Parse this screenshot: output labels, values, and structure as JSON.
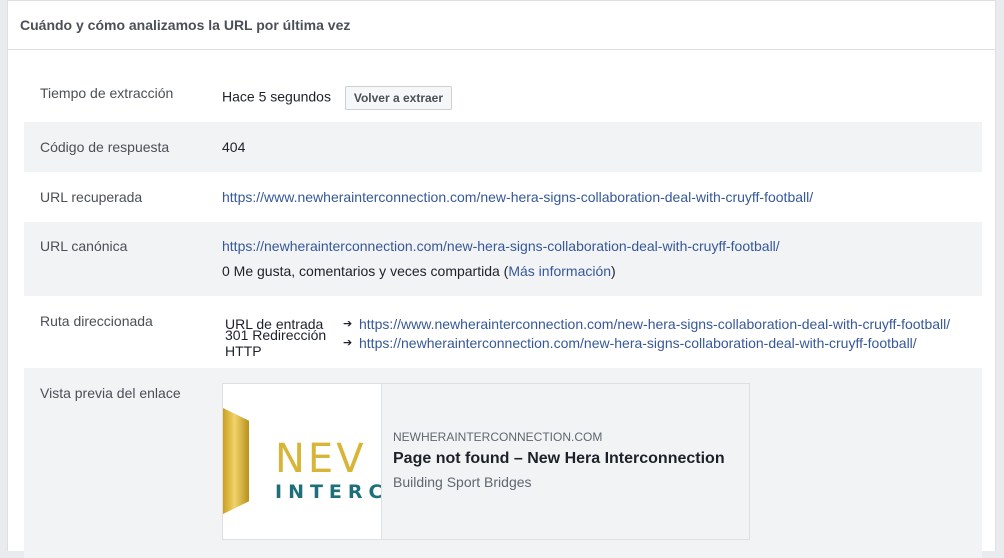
{
  "header": {
    "title": "Cuándo y cómo analizamos la URL por última vez"
  },
  "rows": {
    "scrape_time": {
      "label": "Tiempo de extracción",
      "value": "Hace 5 segundos",
      "button": "Volver a extraer"
    },
    "response_code": {
      "label": "Código de respuesta",
      "value": "404"
    },
    "fetched_url": {
      "label": "URL recuperada",
      "value": "https://www.newherainterconnection.com/new-hera-signs-collaboration-deal-with-cruyff-football/"
    },
    "canonical_url": {
      "label": "URL canónica",
      "value": "https://newherainterconnection.com/new-hera-signs-collaboration-deal-with-cruyff-football/",
      "engagement_text": "0 Me gusta, comentarios y veces compartida (",
      "more_info": "Más información",
      "engagement_close": ")"
    },
    "redirect_path": {
      "label": "Ruta direccionada",
      "entries": [
        {
          "type": "URL de entrada",
          "arrow": "➔",
          "url": "https://www.newherainterconnection.com/new-hera-signs-collaboration-deal-with-cruyff-football/"
        },
        {
          "type": "301 Redirección HTTP",
          "arrow": "➔",
          "url": "https://newherainterconnection.com/new-hera-signs-collaboration-deal-with-cruyff-football/"
        }
      ]
    },
    "link_preview": {
      "label": "Vista previa del enlace",
      "image_logo_top": "NEV",
      "image_logo_bottom": "INTERCO",
      "domain": "NEWHERAINTERCONNECTION.COM",
      "title": "Page not found – New Hera Interconnection",
      "description": "Building Sport Bridges"
    }
  },
  "colors": {
    "link": "#365899",
    "alt_row": "#f2f3f5",
    "gold": "#d8b437",
    "teal": "#1f6f7a"
  }
}
